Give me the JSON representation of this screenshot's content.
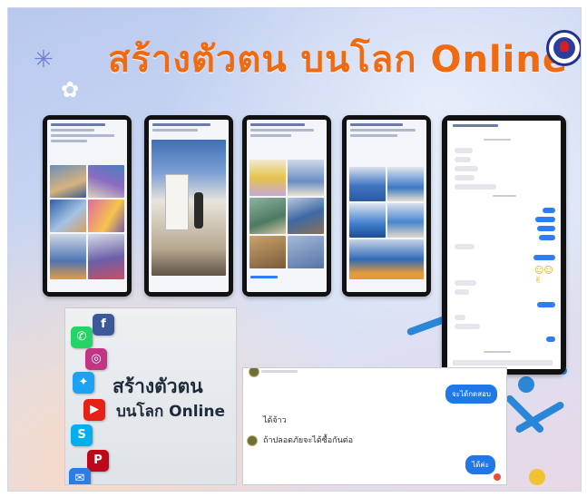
{
  "slide": {
    "title": "สร้างตัวตน  บนโลก Online",
    "logo_icon": "organization-seal-icon",
    "decor_icons": [
      "sparkle-star-icon",
      "flower-icon",
      "hexagon-network-icon"
    ],
    "colors": {
      "title": "#f06a12",
      "accent_blue": "#2a86d6",
      "accent_yellow": "#f1c232"
    }
  },
  "screenshots": [
    {
      "kind": "facebook-post-classroom"
    },
    {
      "kind": "facebook-post-presentation"
    },
    {
      "kind": "facebook-post-products"
    },
    {
      "kind": "facebook-post-group-photo"
    }
  ],
  "messenger": {
    "kind": "messenger-chat-thread"
  },
  "photo_card": {
    "line1": "สร้างตัวตน",
    "line2": "บนโลก Online",
    "app_icons": [
      "whatsapp-icon",
      "facebook-icon",
      "instagram-icon",
      "twitter-icon",
      "youtube-icon",
      "skype-icon",
      "pinterest-icon"
    ]
  },
  "chat_card": {
    "messages": [
      {
        "from": "me",
        "text": "จะได้กดสอบ"
      },
      {
        "from": "them",
        "text": "ได้จ้าว"
      },
      {
        "from": "them",
        "text": "ถ้าปลอดภัยจะได้ซื้อกันต่อ"
      },
      {
        "from": "me",
        "text": "ได้ค่ะ"
      }
    ]
  }
}
